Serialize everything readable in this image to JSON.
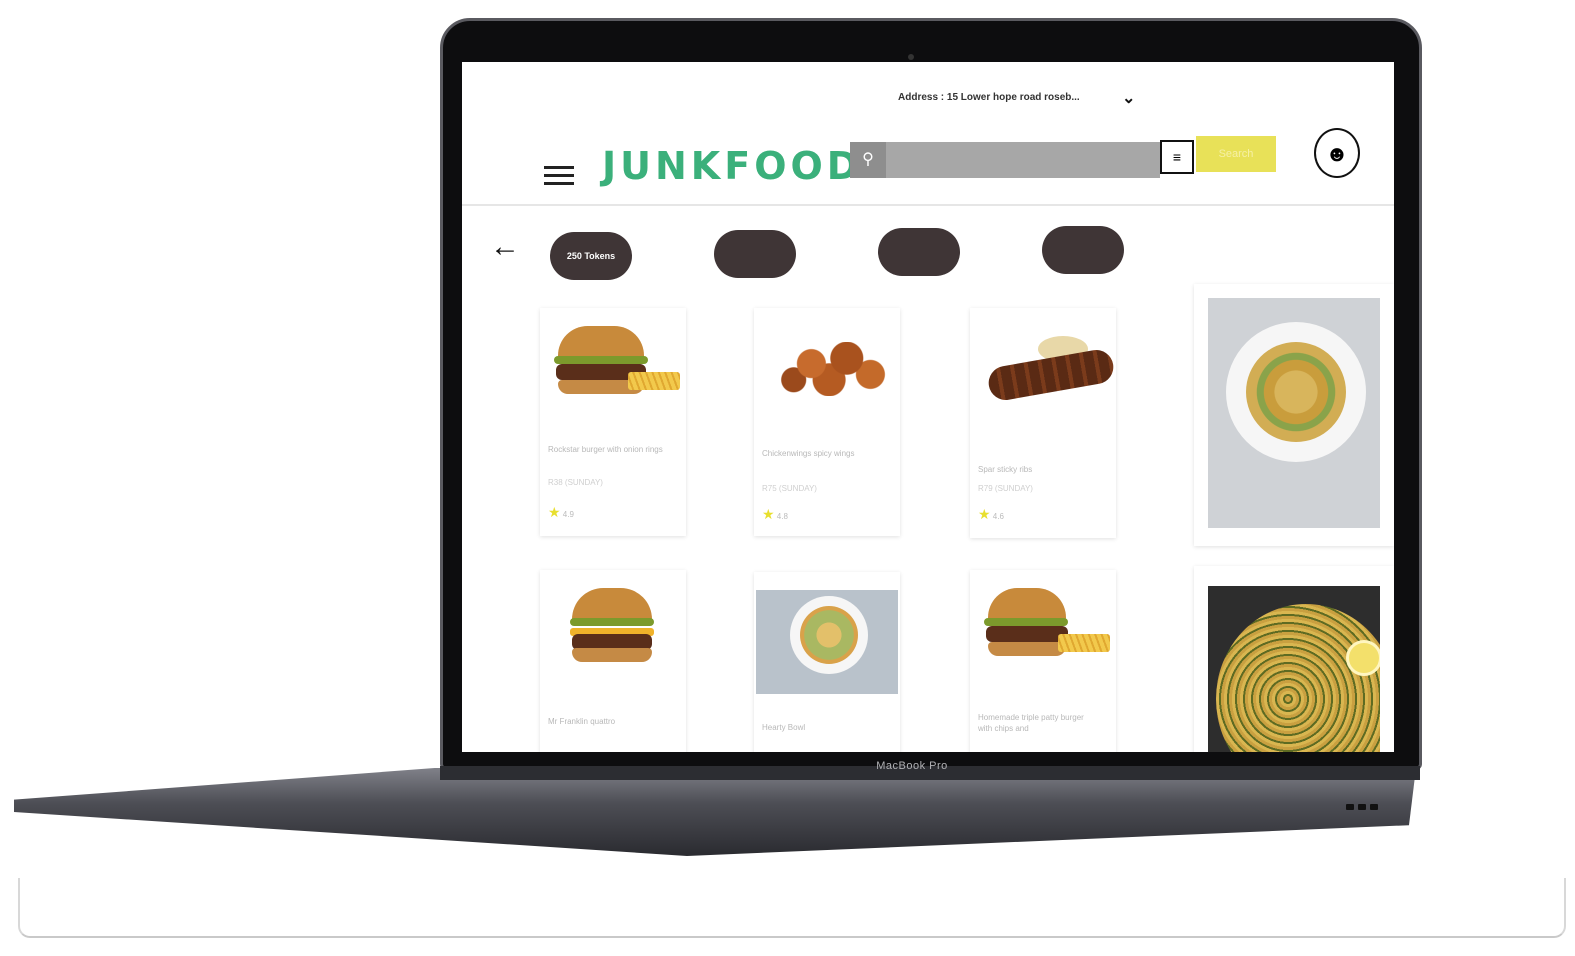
{
  "device": {
    "brand_label": "MacBook Pro"
  },
  "header": {
    "address": "Address : 15 Lower hope road roseb...",
    "logo": "JUNKFOOD",
    "search": {
      "placeholder": "",
      "button_label": "Search"
    }
  },
  "filters": {
    "token_pill": "250 Tokens",
    "pills": [
      "",
      "",
      ""
    ]
  },
  "cards": [
    {
      "name": "Rockstar burger with onion rings",
      "price": "R38 (SUNDAY)",
      "rating": "4.9",
      "image": "burger-with-fries"
    },
    {
      "name": "Chickenwings spicy wings",
      "price": "R75 (SUNDAY)",
      "rating": "4.8",
      "image": "chicken-wings"
    },
    {
      "name": "Spar sticky ribs",
      "price": "R79 (SUNDAY)",
      "rating": "4.6",
      "image": "sticky-ribs"
    },
    {
      "name": "",
      "price": "",
      "rating": "",
      "image": "pasta-plate"
    },
    {
      "name": "Mr Franklin quattro",
      "price": "",
      "rating": "",
      "image": "cheeseburger"
    },
    {
      "name": "Hearty Bowl",
      "price": "",
      "rating": "",
      "image": "salad-bowl"
    },
    {
      "name": "Homemade triple patty burger with chips and",
      "price": "",
      "rating": "",
      "image": "burger-with-fries"
    },
    {
      "name": "",
      "price": "",
      "rating": "",
      "image": "spaghetti-pan"
    }
  ],
  "colors": {
    "logo": "#3bb07b",
    "search_button": "#e8e158",
    "pill": "#3f3536",
    "star": "#e8df2e"
  }
}
